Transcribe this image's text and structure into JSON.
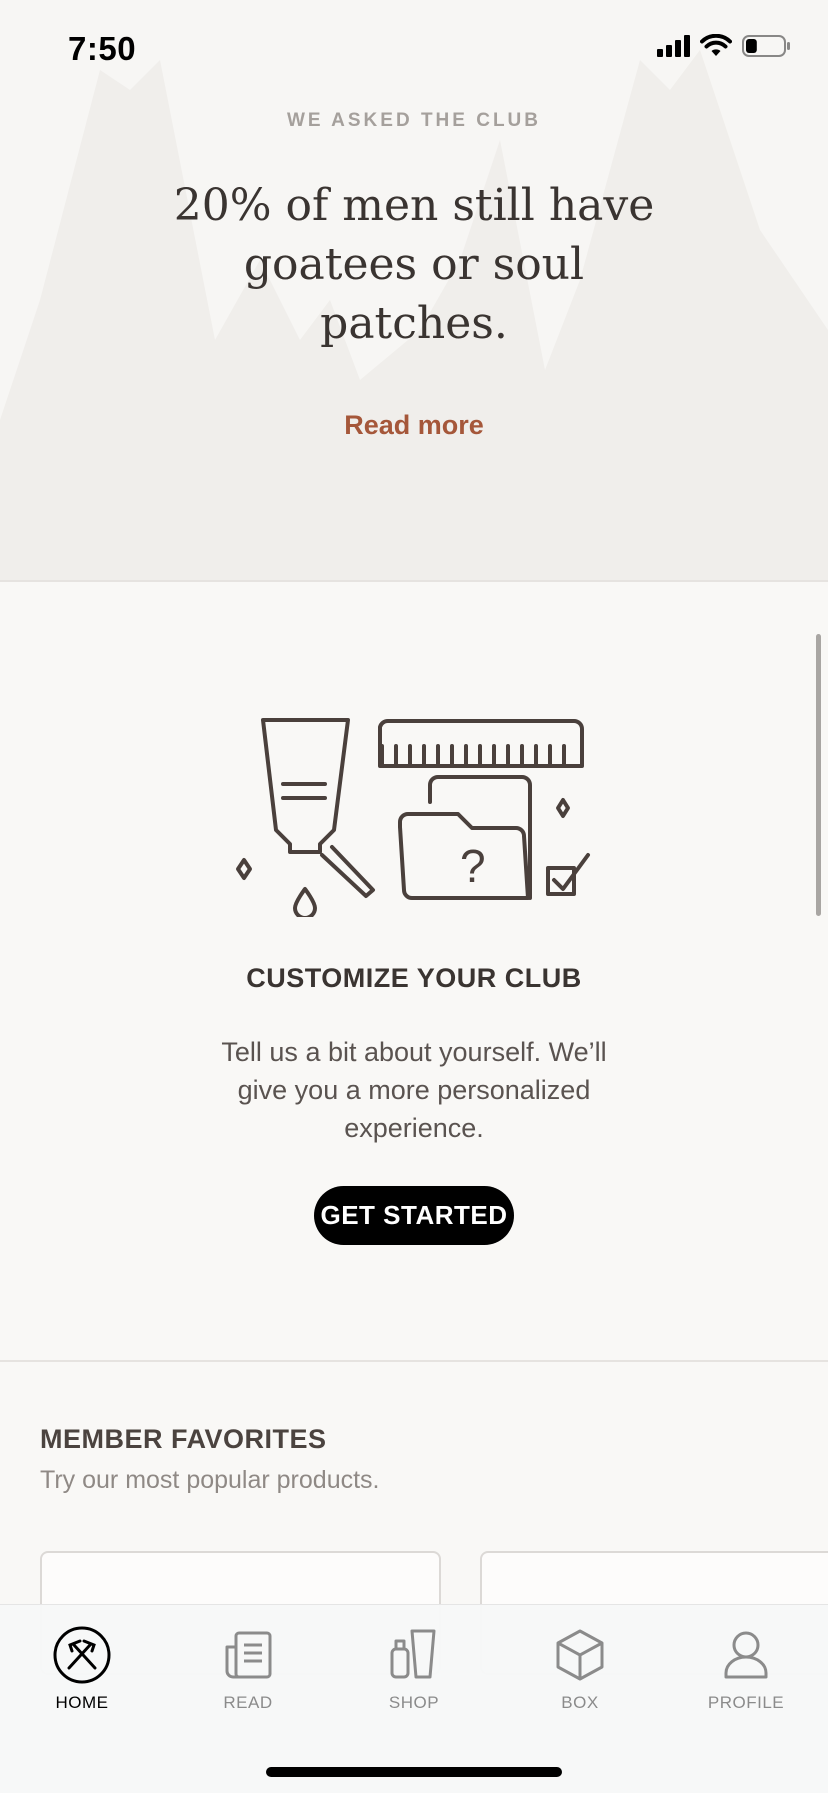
{
  "status_bar": {
    "time": "7:50",
    "battery_level": 0.3
  },
  "survey": {
    "eyebrow": "WE ASKED THE CLUB",
    "quote": "20% of men still have goatees or soul patches.",
    "read_more": "Read more"
  },
  "customize": {
    "title": "CUSTOMIZE YOUR CLUB",
    "body": "Tell us a bit about yourself. We’ll give you a more personalized experience.",
    "button": "GET STARTED",
    "illustration_icons": [
      "tube-icon",
      "comb-icon",
      "folder-question-icon",
      "checkbox-icon",
      "sparkle-icon",
      "drop-icon"
    ]
  },
  "favorites": {
    "title": "MEMBER FAVORITES",
    "subtitle": "Try our most popular products."
  },
  "tabs": [
    {
      "label": "HOME",
      "icon": "home-icon",
      "active": true
    },
    {
      "label": "READ",
      "icon": "read-icon",
      "active": false
    },
    {
      "label": "SHOP",
      "icon": "shop-icon",
      "active": false
    },
    {
      "label": "BOX",
      "icon": "box-icon",
      "active": false
    },
    {
      "label": "PROFILE",
      "icon": "profile-icon",
      "active": false
    }
  ],
  "colors": {
    "accent": "#a5573a",
    "text": "#3a3431",
    "muted": "#8f8985",
    "button": "#000000"
  }
}
